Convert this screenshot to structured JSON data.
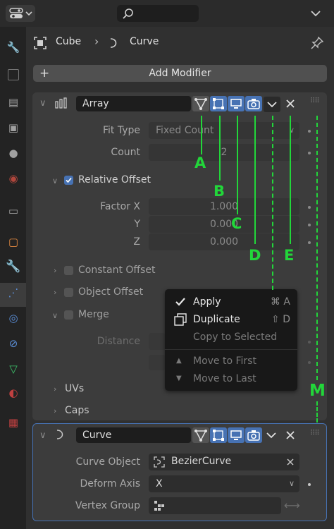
{
  "breadcrumb": {
    "object": "Cube",
    "modifier": "Curve"
  },
  "add_modifier_label": "Add Modifier",
  "array_modifier": {
    "name": "Array",
    "fit_type_label": "Fit Type",
    "fit_type_value": "Fixed Count",
    "count_label": "Count",
    "count_value": "2",
    "relative_offset_label": "Relative Offset",
    "relative_offset_checked": true,
    "factor_x_label": "Factor X",
    "factor_x_value": "1.000",
    "y_label": "Y",
    "y_value": "0.000",
    "z_label": "Z",
    "z_value": "0.000",
    "constant_offset_label": "Constant Offset",
    "object_offset_label": "Object Offset",
    "merge_label": "Merge",
    "distance_label": "Distance",
    "uvs_label": "UVs",
    "caps_label": "Caps"
  },
  "context_menu": {
    "apply": "Apply",
    "apply_shortcut": "⌘ A",
    "duplicate": "Duplicate",
    "duplicate_shortcut": "⇧ D",
    "copy_to_selected": "Copy to Selected",
    "move_to_first": "Move to First",
    "move_to_last": "Move to Last"
  },
  "curve_modifier": {
    "name": "Curve",
    "curve_object_label": "Curve Object",
    "curve_object_value": "BezierCurve",
    "deform_axis_label": "Deform Axis",
    "deform_axis_value": "X",
    "vertex_group_label": "Vertex Group"
  },
  "annotations": {
    "a": "A",
    "b": "B",
    "c": "C",
    "d": "D",
    "e": "E",
    "m": "M"
  },
  "colors": {
    "accent": "#4772b3",
    "annotation": "#22d63a"
  }
}
